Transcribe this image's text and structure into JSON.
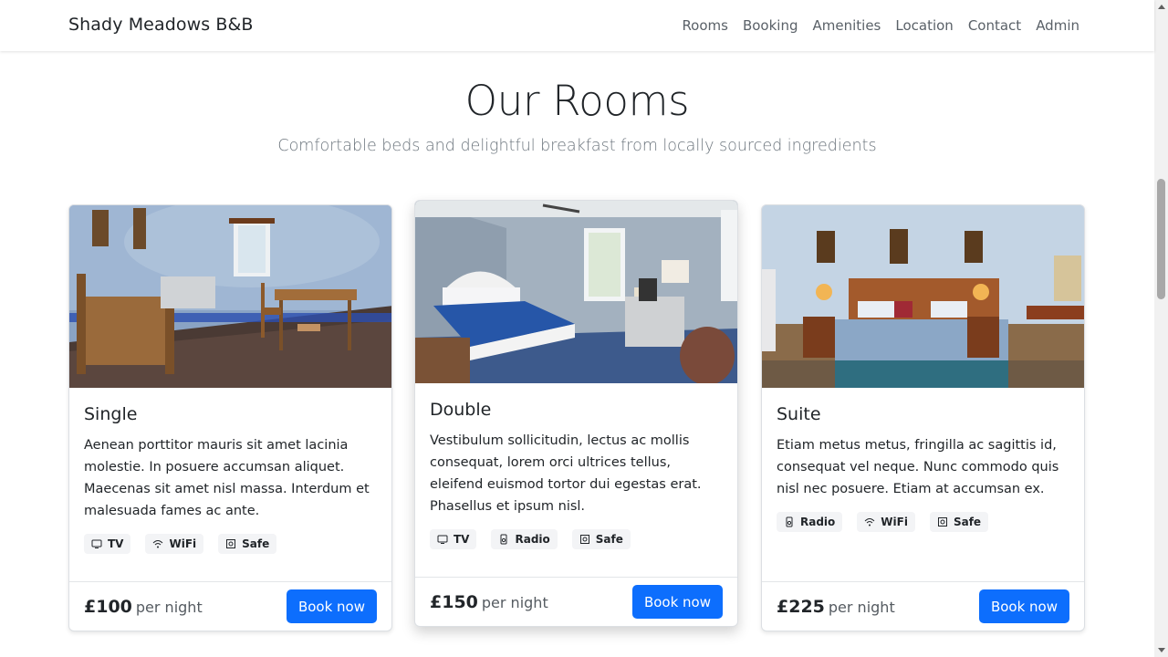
{
  "nav": {
    "brand": "Shady Meadows B&B",
    "links": [
      "Rooms",
      "Booking",
      "Amenities",
      "Location",
      "Contact",
      "Admin"
    ]
  },
  "header": {
    "title": "Our Rooms",
    "subtitle": "Comfortable beds and delightful breakfast from locally sourced ingredients"
  },
  "rooms": [
    {
      "name": "Single",
      "description": "Aenean porttitor mauris sit amet lacinia molestie. In posuere accumsan aliquet. Maecenas sit amet nisl massa. Interdum et malesuada fames ac ante.",
      "features": [
        {
          "label": "TV",
          "icon": "tv-icon"
        },
        {
          "label": "WiFi",
          "icon": "wifi-icon"
        },
        {
          "label": "Safe",
          "icon": "safe-icon"
        }
      ],
      "price": "£100",
      "per": "per night",
      "button": "Book now"
    },
    {
      "name": "Double",
      "description": "Vestibulum sollicitudin, lectus ac mollis consequat, lorem orci ultrices tellus, eleifend euismod tortor dui egestas erat. Phasellus et ipsum nisl.",
      "features": [
        {
          "label": "TV",
          "icon": "tv-icon"
        },
        {
          "label": "Radio",
          "icon": "radio-icon"
        },
        {
          "label": "Safe",
          "icon": "safe-icon"
        }
      ],
      "price": "£150",
      "per": "per night",
      "button": "Book now"
    },
    {
      "name": "Suite",
      "description": "Etiam metus metus, fringilla ac sagittis id, consequat vel neque. Nunc commodo quis nisl nec posuere. Etiam at accumsan ex.",
      "features": [
        {
          "label": "Radio",
          "icon": "radio-icon"
        },
        {
          "label": "WiFi",
          "icon": "wifi-icon"
        },
        {
          "label": "Safe",
          "icon": "safe-icon"
        }
      ],
      "price": "£225",
      "per": "per night",
      "button": "Book now"
    }
  ],
  "colors": {
    "primary": "#0d6efd",
    "muted": "#6c757d",
    "text": "#212529"
  }
}
